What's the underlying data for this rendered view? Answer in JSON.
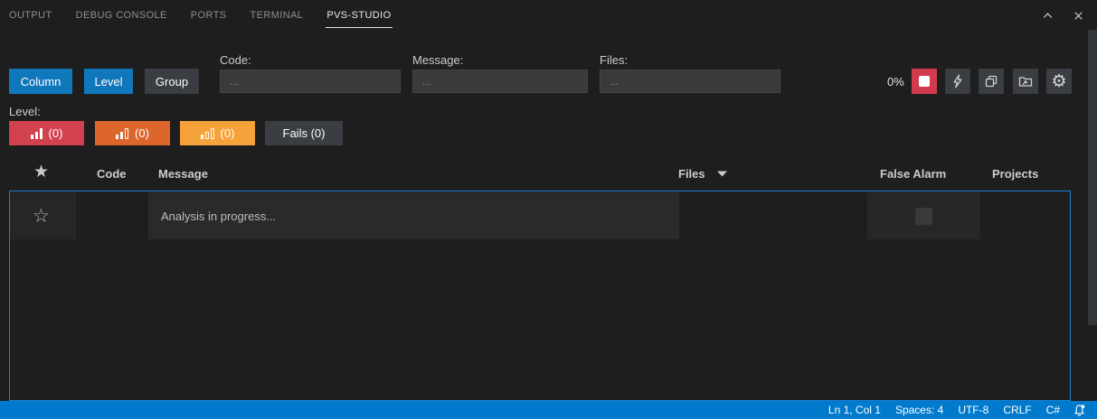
{
  "panel": {
    "tabs": [
      {
        "label": "OUTPUT",
        "active": false
      },
      {
        "label": "DEBUG CONSOLE",
        "active": false
      },
      {
        "label": "PORTS",
        "active": false
      },
      {
        "label": "TERMINAL",
        "active": false
      },
      {
        "label": "PVS-STUDIO",
        "active": true
      }
    ],
    "window_icons": [
      "chevron-up-icon",
      "close-icon"
    ]
  },
  "toolbar": {
    "column_label": "Column",
    "level_label": "Level",
    "group_label": "Group",
    "filters": {
      "code": {
        "label": "Code:",
        "placeholder": "...",
        "value": ""
      },
      "message": {
        "label": "Message:",
        "placeholder": "...",
        "value": ""
      },
      "files": {
        "label": "Files:",
        "placeholder": "...",
        "value": ""
      }
    },
    "progress": "0%",
    "action_icons": [
      "stop-icon",
      "lightning-icon",
      "copy-icon",
      "open-folder-icon",
      "gear-icon"
    ]
  },
  "level_filter": {
    "label": "Level:",
    "high": {
      "count": "(0)",
      "icon": "bar-chart-3-solid-icon"
    },
    "medium": {
      "count": "(0)",
      "icon": "bar-chart-2-solid-icon"
    },
    "low": {
      "count": "(0)",
      "icon": "bar-chart-1-solid-icon"
    },
    "fails": {
      "label": "Fails (0)"
    }
  },
  "table": {
    "headers": {
      "favorite_icon": "star-filled-icon",
      "code": "Code",
      "message": "Message",
      "files": "Files",
      "files_sort_icon": "caret-down-icon",
      "false_alarm": "False Alarm",
      "projects": "Projects"
    },
    "rows": [
      {
        "favorite_icon": "star-outline-icon",
        "code": "",
        "message": "Analysis in progress...",
        "false_alarm_checked": false
      }
    ]
  },
  "status_bar": {
    "cursor": "Ln 1, Col 1",
    "indent": "Spaces: 4",
    "encoding": "UTF-8",
    "eol": "CRLF",
    "language": "C#",
    "bell_icon": "bell-dot-icon"
  },
  "glyphs": {
    "star_filled": "★",
    "star_outline": "☆",
    "gear": "⚙"
  },
  "colors": {
    "accent_blue": "#1177bb",
    "stop_red": "#d23b4e",
    "level_high": "#d1424e",
    "level_medium": "#dd662d",
    "level_low": "#f5a23a",
    "secondary_button": "#3a3d41",
    "focus_border": "#1f7fd4",
    "status_bar": "#007acc",
    "panel_background": "#1e1e1e"
  }
}
